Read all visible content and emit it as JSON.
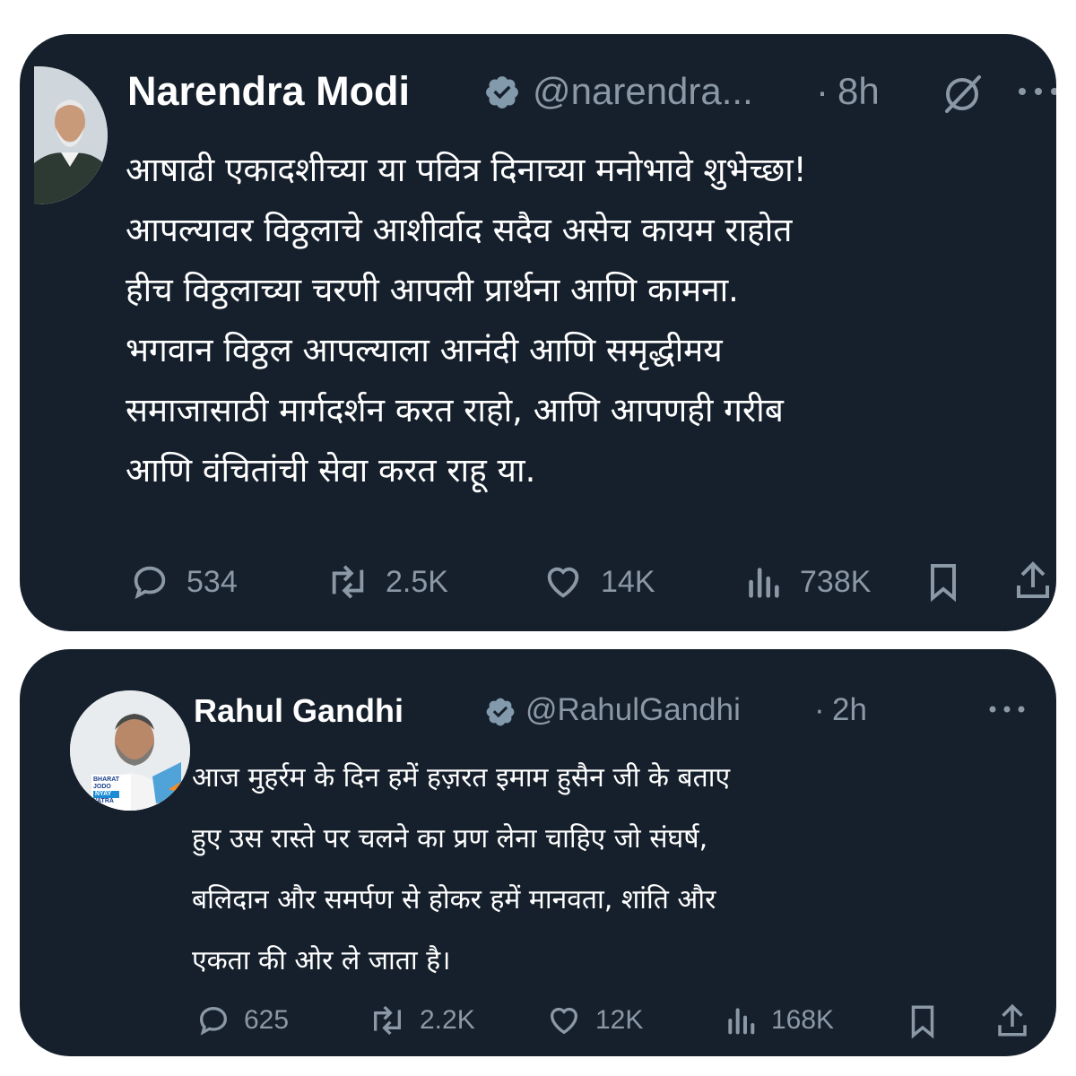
{
  "tweets": [
    {
      "name": "Narendra Modi",
      "handle": "@narendra...",
      "separator": "·",
      "time": "8h",
      "text_lines": [
        "आषाढी एकादशीच्या या पवित्र दिनाच्या मनोभावे शुभेच्छा!",
        "आपल्यावर विठ्ठलाचे आशीर्वाद सदैव असेच कायम राहोत",
        "हीच विठ्ठलाच्या चरणी आपली प्रार्थना आणि कामना.",
        "भगवान विठ्ठल आपल्याला आनंदी आणि समृद्धीमय",
        "समाजासाठी मार्गदर्शन करत राहो, आणि आपणही गरीब",
        "आणि वंचितांची सेवा करत राहू या."
      ],
      "replies": "534",
      "reposts": "2.5K",
      "likes": "14K",
      "views": "738K"
    },
    {
      "name": "Rahul Gandhi",
      "handle": "@RahulGandhi",
      "separator": "·",
      "time": "2h",
      "text_lines": [
        "आज मुहर्रम के दिन हमें हज़रत इमाम हुसैन जी के बताए",
        "हुए उस रास्ते पर चलने का प्रण लेना चाहिए जो संघर्ष,",
        "बलिदान और समर्पण से होकर हमें मानवता, शांति और",
        "एकता की ओर ले जाता है।"
      ],
      "avatar_badge_lines": [
        "BHARAT",
        "JODO",
        "NYAY",
        "YATRA"
      ],
      "replies": "625",
      "reposts": "2.2K",
      "likes": "12K",
      "views": "168K"
    }
  ],
  "icons": [
    "verified-badge-icon",
    "grok-icon",
    "more-icon",
    "reply-icon",
    "repost-icon",
    "like-icon",
    "views-icon",
    "bookmark-icon",
    "share-icon"
  ],
  "colors": {
    "card_bg": "#16202c",
    "text": "#ffffff",
    "muted": "#8b98a5",
    "page_bg": "#ffffff"
  }
}
